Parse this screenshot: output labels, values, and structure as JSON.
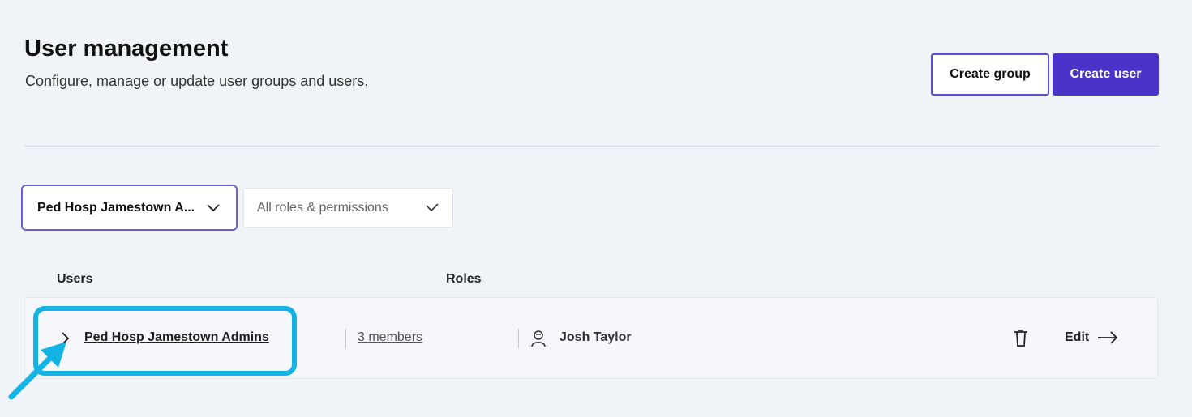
{
  "header": {
    "title": "User management",
    "subtitle": "Configure, manage or update user groups and users."
  },
  "actions": {
    "create_group_label": "Create group",
    "create_user_label": "Create user"
  },
  "filters": {
    "group_selected": "Ped Hosp Jamestown A...",
    "roles_selected": "All roles & permissions"
  },
  "table": {
    "columns": [
      "Users",
      "Roles"
    ],
    "rows": [
      {
        "group_name": "Ped Hosp Jamestown Admins",
        "members_label": "3 members",
        "role_user": "Josh Taylor",
        "edit_label": "Edit"
      }
    ]
  },
  "icons": {
    "expand": "chevron-right-icon",
    "user": "user-badge-icon",
    "delete": "trash-icon",
    "edit_arrow": "arrow-right-icon",
    "dropdown": "chevron-down-icon"
  },
  "colors": {
    "primary": "#4a33c9",
    "outline_border": "#5b4fcf",
    "annotation": "#14b3e6",
    "background": "#f0f3f8"
  }
}
